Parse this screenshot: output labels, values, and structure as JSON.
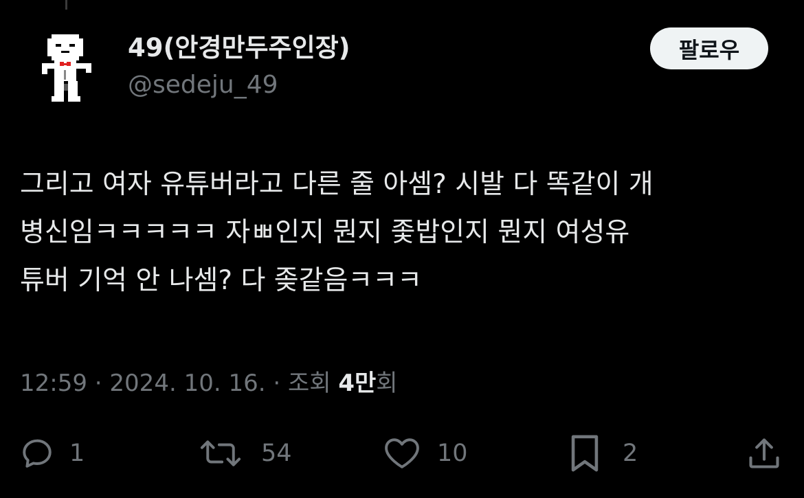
{
  "author": {
    "display_name": "49(안경만두주인장)",
    "handle": "@sedeju_49",
    "avatar_icon": "pixel-character-avatar"
  },
  "follow_label": "팔로우",
  "tweet": {
    "lines": [
      "그리고 여자 유튜버라고 다른 줄 아셈? 시발 다 똑같이 개",
      "병신임ㅋㅋㅋㅋㅋ 자ㅃ인지 뭔지 좇밥인지 뭔지 여성유",
      "튜버 기억 안 나셈? 다 좆같음ㅋㅋㅋ"
    ]
  },
  "meta": {
    "time": "12:59",
    "separator": "·",
    "date": "2024. 10. 16.",
    "views_label": "조회",
    "views_count": "4만",
    "views_suffix": "회"
  },
  "actions": {
    "replies": "1",
    "retweets": "54",
    "likes": "10",
    "bookmarks": "2"
  },
  "colors": {
    "background": "#000000",
    "primary_text": "#e7e9ea",
    "secondary_text": "#71767b",
    "follow_bg": "#eff3f4"
  }
}
